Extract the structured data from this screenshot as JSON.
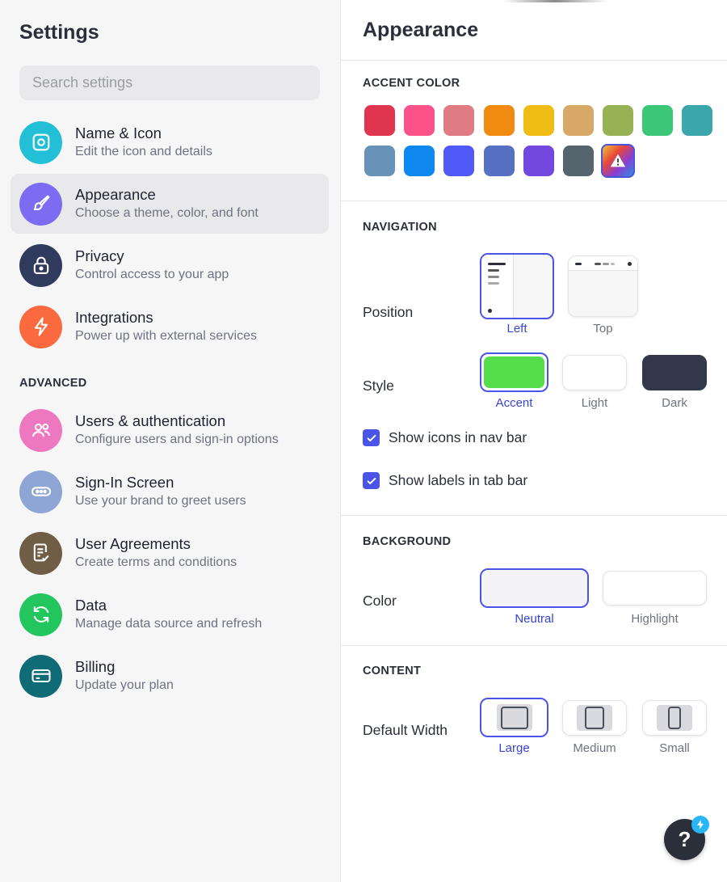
{
  "sidebar": {
    "title": "Settings",
    "search_placeholder": "Search settings",
    "advanced_label": "ADVANCED",
    "items": [
      {
        "label": "Name & Icon",
        "sub": "Edit the icon and details",
        "color": "#22bfd6",
        "icon": "app-square-icon"
      },
      {
        "label": "Appearance",
        "sub": "Choose a theme, color, and font",
        "color": "#7d6cf2",
        "icon": "brush-icon"
      },
      {
        "label": "Privacy",
        "sub": "Control access to your app",
        "color": "#2f3a5c",
        "icon": "lock-icon"
      },
      {
        "label": "Integrations",
        "sub": "Power up with external services",
        "color": "#fb6a3e",
        "icon": "lightning-icon"
      },
      {
        "label": "Users & authentication",
        "sub": "Configure users and sign-in options",
        "color": "#ee78bf",
        "icon": "users-icon"
      },
      {
        "label": "Sign-In Screen",
        "sub": "Use your brand to greet users",
        "color": "#8ea5d6",
        "icon": "password-icon"
      },
      {
        "label": "User Agreements",
        "sub": "Create terms and conditions",
        "color": "#6f5e45",
        "icon": "document-check-icon"
      },
      {
        "label": "Data",
        "sub": "Manage data source and refresh",
        "color": "#22c55e",
        "icon": "refresh-icon"
      },
      {
        "label": "Billing",
        "sub": "Update your plan",
        "color": "#0f6b76",
        "icon": "credit-card-icon"
      }
    ]
  },
  "main": {
    "title": "Appearance",
    "accent": {
      "heading": "ACCENT COLOR",
      "colors": [
        "#e0354f",
        "#fb528a",
        "#df7b82",
        "#f08a10",
        "#f0bd17",
        "#d8a866",
        "#97b255",
        "#3cc677",
        "#3ba6ab",
        "#6793b9",
        "#0e88ee",
        "#5159f6",
        "#5870c2",
        "#7248df",
        "#56646e"
      ]
    },
    "navigation": {
      "heading": "NAVIGATION",
      "position_label": "Position",
      "position_options": [
        "Left",
        "Top"
      ],
      "style_label": "Style",
      "style_options": [
        {
          "label": "Accent",
          "color": "#55dd4b"
        },
        {
          "label": "Light",
          "color": "#ffffff"
        },
        {
          "label": "Dark",
          "color": "#323849"
        }
      ],
      "show_icons": "Show icons in nav bar",
      "show_labels": "Show labels in tab bar"
    },
    "background": {
      "heading": "BACKGROUND",
      "color_label": "Color",
      "options": [
        "Neutral",
        "Highlight"
      ]
    },
    "content": {
      "heading": "CONTENT",
      "width_label": "Default Width",
      "options": [
        "Large",
        "Medium",
        "Small"
      ]
    }
  },
  "help": {
    "label": "?"
  }
}
